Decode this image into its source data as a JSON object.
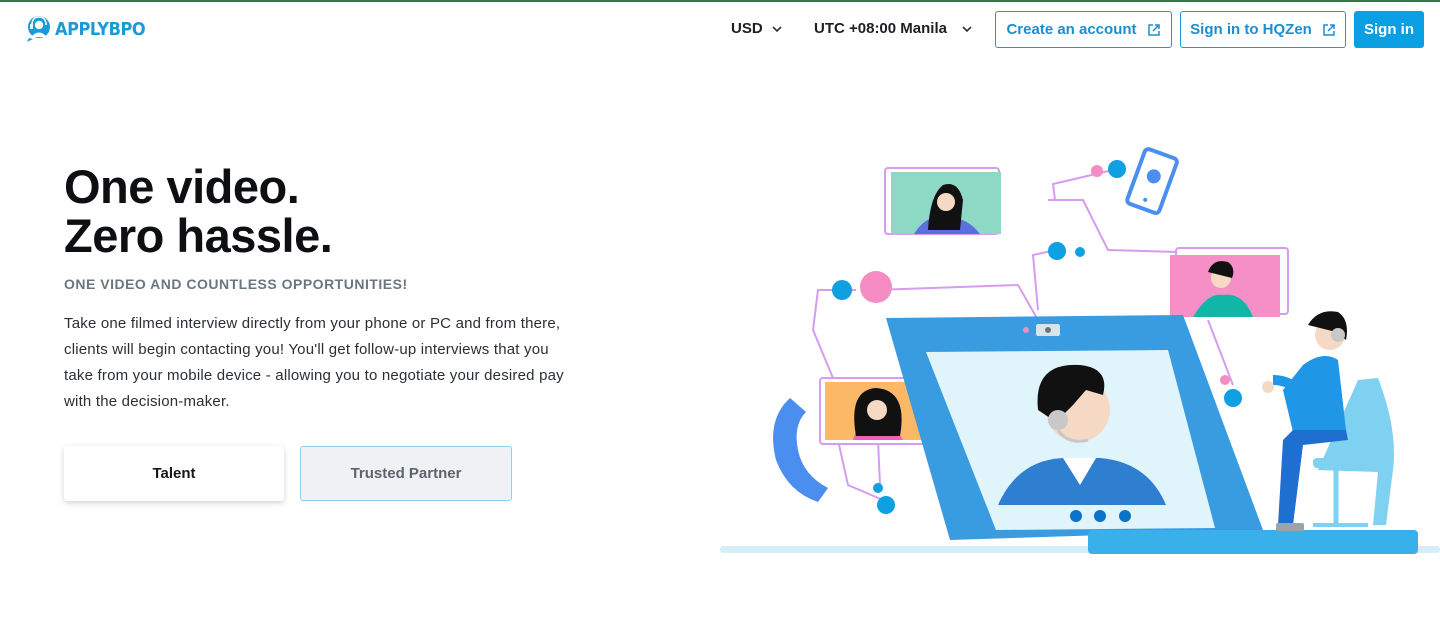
{
  "header": {
    "logo_text": "APPLYBPO",
    "currency": "USD",
    "timezone": "UTC +08:00 Manila",
    "create_account_label": "Create an account",
    "sign_in_hqzen_label": "Sign in to HQZen",
    "sign_in_label": "Sign in"
  },
  "hero": {
    "title_line1": "One video.",
    "title_line2": "Zero hassle.",
    "subtitle": "ONE VIDEO AND COUNTLESS OPPORTUNITIES!",
    "body": "Take one filmed interview directly from your phone or PC and from there, clients will begin contacting you! You'll get follow-up interviews that you take from your mobile device - allowing you to negotiate your desired pay with the decision-maker."
  },
  "tabs": {
    "talent_label": "Talent",
    "partner_label": "Trusted Partner",
    "selected": "Talent"
  },
  "icons": {
    "logo": "headset-person-logo-icon",
    "currency_dropdown": "chevron-down-icon",
    "timezone_dropdown": "chevron-down-icon",
    "create_account": "external-link-icon",
    "sign_in_hqzen": "external-link-icon"
  },
  "colors": {
    "brand": "#1a9ad6",
    "primary_button": "#0a9ee3",
    "title_text": "#0d0f12",
    "subtitle_text": "#6b7681"
  }
}
